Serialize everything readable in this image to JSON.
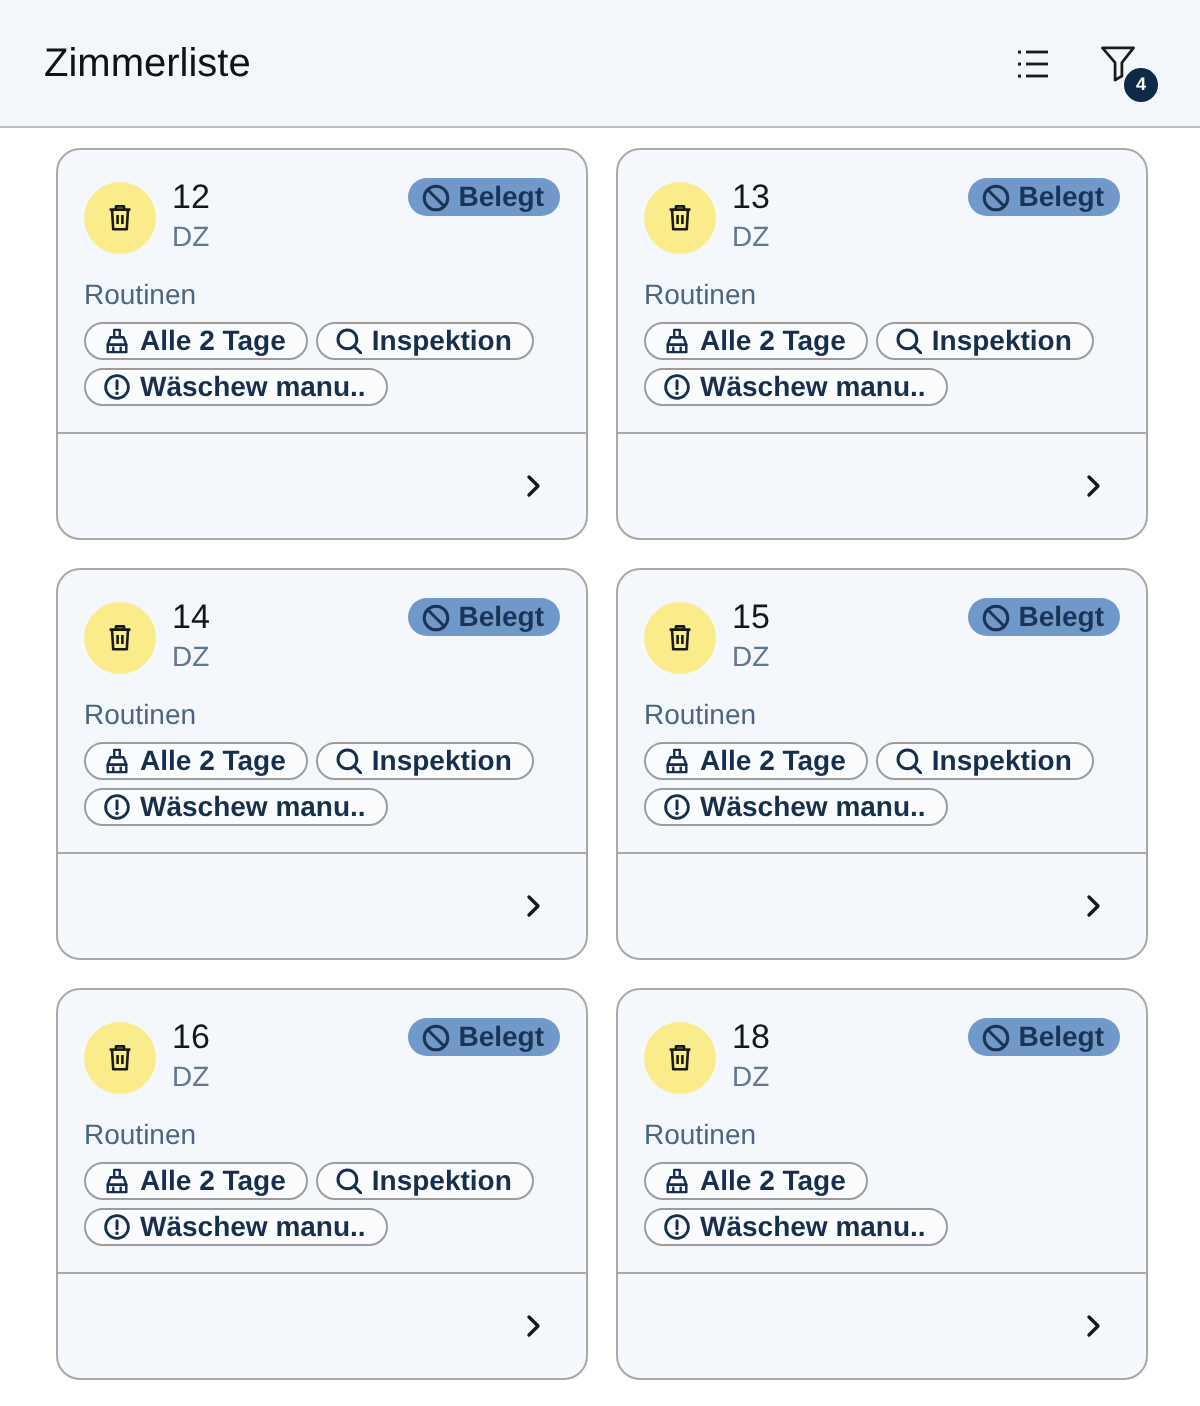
{
  "header": {
    "title": "Zimmerliste",
    "filter_count": "4"
  },
  "rooms": [
    {
      "number": "12",
      "type": "DZ",
      "status": {
        "label": "Belegt",
        "kind": "occupied"
      },
      "routines_label": "Routinen",
      "routines": [
        {
          "kind": "cleaning",
          "label": "Alle 2 Tage"
        },
        {
          "kind": "inspection",
          "label": "Inspektion"
        },
        {
          "kind": "laundry",
          "label": "Wäschew manu.."
        }
      ]
    },
    {
      "number": "13",
      "type": "DZ",
      "status": {
        "label": "Belegt",
        "kind": "occupied"
      },
      "routines_label": "Routinen",
      "routines": [
        {
          "kind": "cleaning",
          "label": "Alle 2 Tage"
        },
        {
          "kind": "inspection",
          "label": "Inspektion"
        },
        {
          "kind": "laundry",
          "label": "Wäschew manu.."
        }
      ]
    },
    {
      "number": "14",
      "type": "DZ",
      "status": {
        "label": "Belegt",
        "kind": "occupied"
      },
      "routines_label": "Routinen",
      "routines": [
        {
          "kind": "cleaning",
          "label": "Alle 2 Tage"
        },
        {
          "kind": "inspection",
          "label": "Inspektion"
        },
        {
          "kind": "laundry",
          "label": "Wäschew manu.."
        }
      ]
    },
    {
      "number": "15",
      "type": "DZ",
      "status": {
        "label": "Belegt",
        "kind": "occupied"
      },
      "routines_label": "Routinen",
      "routines": [
        {
          "kind": "cleaning",
          "label": "Alle 2 Tage"
        },
        {
          "kind": "inspection",
          "label": "Inspektion"
        },
        {
          "kind": "laundry",
          "label": "Wäschew manu.."
        }
      ]
    },
    {
      "number": "16",
      "type": "DZ",
      "status": {
        "label": "Belegt",
        "kind": "occupied"
      },
      "routines_label": "Routinen",
      "routines": [
        {
          "kind": "cleaning",
          "label": "Alle 2 Tage"
        },
        {
          "kind": "inspection",
          "label": "Inspektion"
        },
        {
          "kind": "laundry",
          "label": "Wäschew manu.."
        }
      ]
    },
    {
      "number": "18",
      "type": "DZ",
      "status": {
        "label": "Belegt",
        "kind": "occupied"
      },
      "routines_label": "Routinen",
      "routines": [
        {
          "kind": "cleaning",
          "label": "Alle 2 Tage"
        },
        {
          "kind": "laundry",
          "label": "Wäschew manu.."
        }
      ]
    }
  ]
}
